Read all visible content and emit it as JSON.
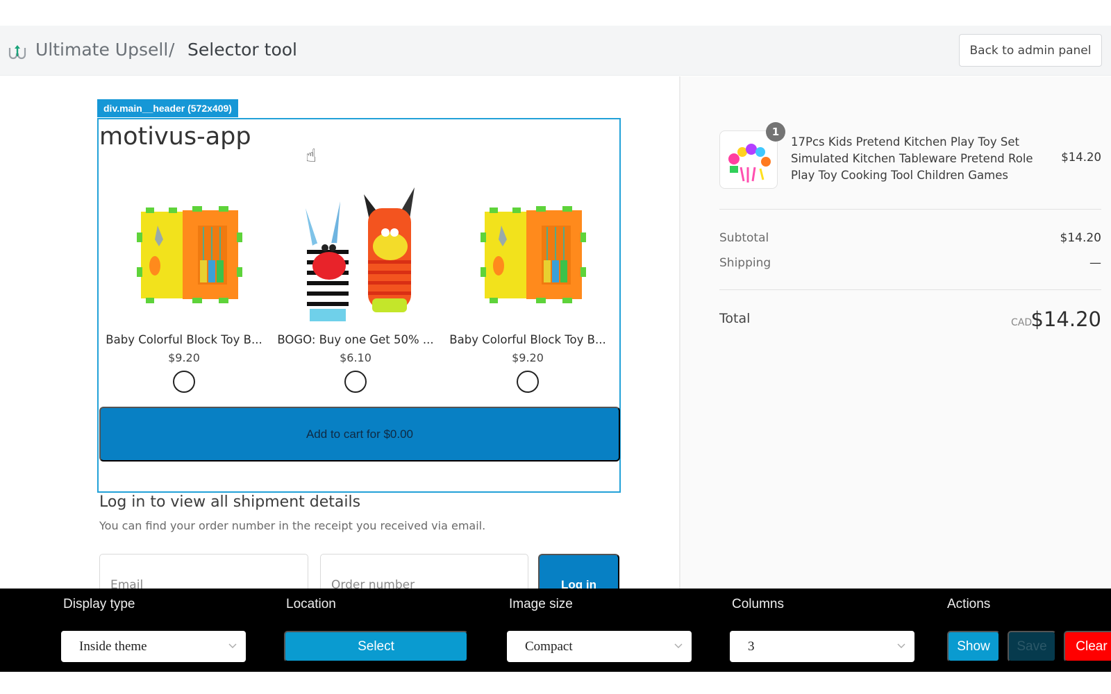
{
  "header": {
    "app_name": "Ultimate Upsell",
    "separator": "/",
    "page_title": "Selector tool",
    "back_button": "Back to admin panel"
  },
  "preview": {
    "selector_tag": "div.main__header (572x409)",
    "store_title": "motivus-app",
    "products": [
      {
        "name": "Baby Colorful Block Toy B...",
        "price": "$9.20",
        "image": "block-toy"
      },
      {
        "name": "BOGO: Buy one Get 50% ...",
        "price": "$6.10",
        "image": "rattle-socks"
      },
      {
        "name": "Baby Colorful Block Toy B...",
        "price": "$9.20",
        "image": "block-toy"
      }
    ],
    "add_to_cart": "Add to cart for $0.00",
    "login_heading": "Log in to view all shipment details",
    "login_text": "You can find your order number in the receipt you received via email.",
    "email_placeholder": "Email",
    "order_placeholder": "Order number",
    "login_button": "Log in"
  },
  "order_summary": {
    "item": {
      "quantity": "1",
      "name": "17Pcs Kids Pretend Kitchen Play Toy Set Simulated Kitchen Tableware Pretend Role Play Toy Cooking Tool Children Games",
      "price": "$14.20"
    },
    "subtotal_label": "Subtotal",
    "subtotal_value": "$14.20",
    "shipping_label": "Shipping",
    "shipping_value": "—",
    "total_label": "Total",
    "total_currency": "CAD",
    "total_value": "$14.20"
  },
  "toolbar": {
    "display_type_label": "Display type",
    "display_type_value": "Inside theme",
    "location_label": "Location",
    "location_button": "Select",
    "image_size_label": "Image size",
    "image_size_value": "Compact",
    "columns_label": "Columns",
    "columns_value": "3",
    "actions_label": "Actions",
    "show_button": "Show",
    "save_button": "Save",
    "clear_button": "Clear"
  },
  "colors": {
    "accent_blue": "#0880c4",
    "selector_blue": "#1697d6",
    "toolbar_button_blue": "#0a9bd0",
    "save_disabled": "#063a4d",
    "clear_red": "#ff0000"
  }
}
